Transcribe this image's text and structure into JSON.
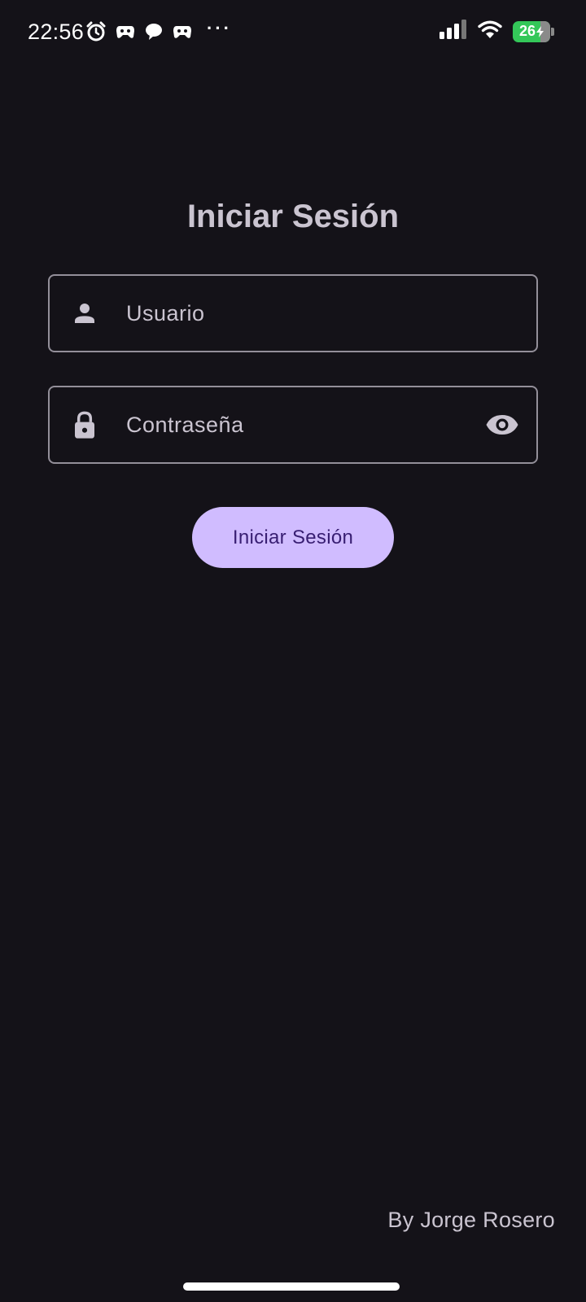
{
  "status_bar": {
    "time": "22:56",
    "notification_icons": [
      "alarm-icon",
      "game-controller-icon",
      "chat-bubble-icon",
      "game-controller-icon"
    ],
    "more_indicator": "···",
    "battery_level": "26",
    "battery_color": "#34c759"
  },
  "login": {
    "title": "Iniciar Sesión",
    "username": {
      "placeholder": "Usuario",
      "value": "",
      "icon": "person-icon"
    },
    "password": {
      "placeholder": "Contraseña",
      "value": "",
      "icon": "lock-icon",
      "toggle_icon": "eye-icon"
    },
    "submit_label": "Iniciar Sesión"
  },
  "footer": {
    "credit": "By Jorge Rosero"
  },
  "colors": {
    "background": "#141218",
    "primary": "#d0bcff",
    "on_primary": "#381e72",
    "outline": "#938f99",
    "on_surface_variant": "#cac4d0"
  }
}
